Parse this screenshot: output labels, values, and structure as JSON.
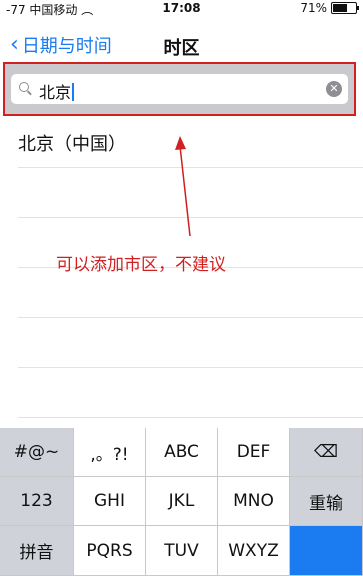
{
  "status_bar": {
    "carrier": "-77 中国移动",
    "time": "17:08",
    "battery": "71%",
    "battery_level": 0.71
  },
  "nav": {
    "back_label": "日期与时间",
    "title": "时区"
  },
  "search": {
    "value": "北京"
  },
  "results": [
    {
      "label": "北京（中国）"
    },
    {
      "label": ""
    },
    {
      "label": ""
    },
    {
      "label": ""
    },
    {
      "label": ""
    },
    {
      "label": ""
    }
  ],
  "annotation": {
    "text": "可以添加市区，不建议"
  },
  "keyboard": {
    "row1": [
      "#@~",
      ",。?!",
      "ABC",
      "DEF"
    ],
    "row2": [
      "123",
      "GHI",
      "JKL",
      "MNO"
    ],
    "row3": [
      "拼音",
      "PQRS",
      "TUV",
      "WXYZ"
    ],
    "delete_icon": "delete-icon",
    "retype_label": "重输"
  }
}
